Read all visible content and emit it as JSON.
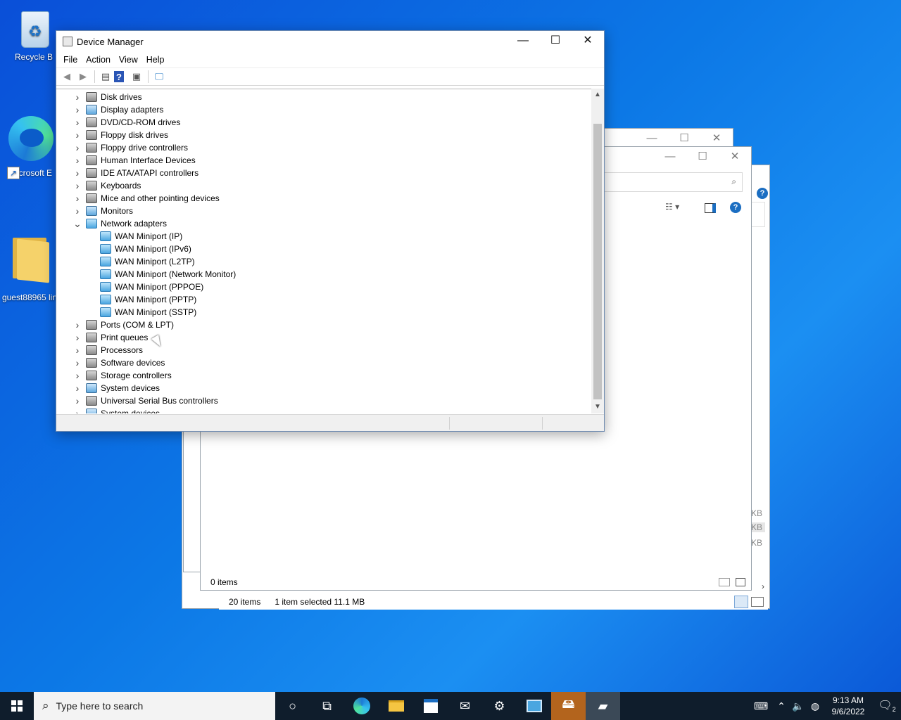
{
  "desktop": {
    "icons": [
      {
        "label": "Recycle B",
        "icon": "recycle-bin-icon"
      },
      {
        "label": "Microsoft E",
        "icon": "edge-icon"
      },
      {
        "label": "guest88965 lin",
        "icon": "folder-icon"
      }
    ]
  },
  "explorer_back": {
    "status_items": "20 items",
    "status_selected": "1 item selected  11.1 MB",
    "status_items_front": "0 items",
    "sizes": [
      "KB",
      "KB",
      "KB"
    ]
  },
  "device_manager": {
    "title": "Device Manager",
    "menu": [
      "File",
      "Action",
      "View",
      "Help"
    ],
    "toolbar_icons": [
      "back-arrow-icon",
      "forward-arrow-icon",
      "properties-icon",
      "help-icon",
      "update-driver-icon",
      "scan-hardware-icon"
    ],
    "tree": [
      {
        "label": "Disk drives",
        "expanded": false,
        "level": 0
      },
      {
        "label": "Display adapters",
        "expanded": false,
        "level": 0
      },
      {
        "label": "DVD/CD-ROM drives",
        "expanded": false,
        "level": 0
      },
      {
        "label": "Floppy disk drives",
        "expanded": false,
        "level": 0
      },
      {
        "label": "Floppy drive controllers",
        "expanded": false,
        "level": 0
      },
      {
        "label": "Human Interface Devices",
        "expanded": false,
        "level": 0
      },
      {
        "label": "IDE ATA/ATAPI controllers",
        "expanded": false,
        "level": 0
      },
      {
        "label": "Keyboards",
        "expanded": false,
        "level": 0
      },
      {
        "label": "Mice and other pointing devices",
        "expanded": false,
        "level": 0
      },
      {
        "label": "Monitors",
        "expanded": false,
        "level": 0
      },
      {
        "label": "Network adapters",
        "expanded": true,
        "level": 0
      },
      {
        "label": "WAN Miniport (IP)",
        "level": 1
      },
      {
        "label": "WAN Miniport (IPv6)",
        "level": 1
      },
      {
        "label": "WAN Miniport (L2TP)",
        "level": 1
      },
      {
        "label": "WAN Miniport (Network Monitor)",
        "level": 1
      },
      {
        "label": "WAN Miniport (PPPOE)",
        "level": 1
      },
      {
        "label": "WAN Miniport (PPTP)",
        "level": 1
      },
      {
        "label": "WAN Miniport (SSTP)",
        "level": 1
      },
      {
        "label": "Ports (COM & LPT)",
        "expanded": false,
        "level": 0
      },
      {
        "label": "Print queues",
        "expanded": false,
        "level": 0
      },
      {
        "label": "Processors",
        "expanded": false,
        "level": 0
      },
      {
        "label": "Software devices",
        "expanded": false,
        "level": 0
      },
      {
        "label": "Storage controllers",
        "expanded": false,
        "level": 0
      },
      {
        "label": "System devices",
        "expanded": false,
        "level": 0
      },
      {
        "label": "Universal Serial Bus controllers",
        "expanded": false,
        "level": 0
      },
      {
        "label": "System devices",
        "expanded": false,
        "level": 0
      }
    ]
  },
  "taskbar": {
    "search_placeholder": "Type here to search",
    "time": "9:13 AM",
    "date": "9/6/2022",
    "notification_count": "2"
  }
}
